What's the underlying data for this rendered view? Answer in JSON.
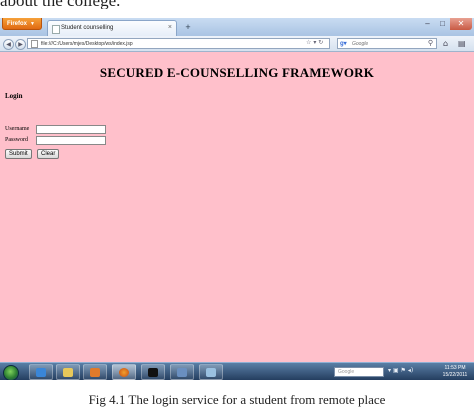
{
  "document": {
    "above_text": "about the college.",
    "caption": "Fig 4.1 The login service for a student from remote place"
  },
  "browser": {
    "menu_label": "Firefox",
    "tab_title": "Student counselling",
    "url": "file:///C:/Users/mjes/Desktop/ws/index.jsp",
    "search_placeholder": "Google",
    "search_engine_icon": "google-icon"
  },
  "page": {
    "title": "SECURED E-COUNSELLING FRAMEWORK",
    "login_heading": "Login",
    "username_label": "Username",
    "password_label": "Password",
    "username_value": "",
    "password_value": "",
    "submit_label": "Submit",
    "clear_label": "Clear",
    "background_color": "#ffc0cb"
  },
  "taskbar": {
    "search_placeholder": "Google",
    "clock_time": "11:53 PM",
    "clock_date": "15/22/2011",
    "apps": [
      "ie-icon",
      "folder-icon",
      "media-player-icon",
      "firefox-icon",
      "terminal-icon",
      "task-manager-icon",
      "paint-icon"
    ]
  }
}
